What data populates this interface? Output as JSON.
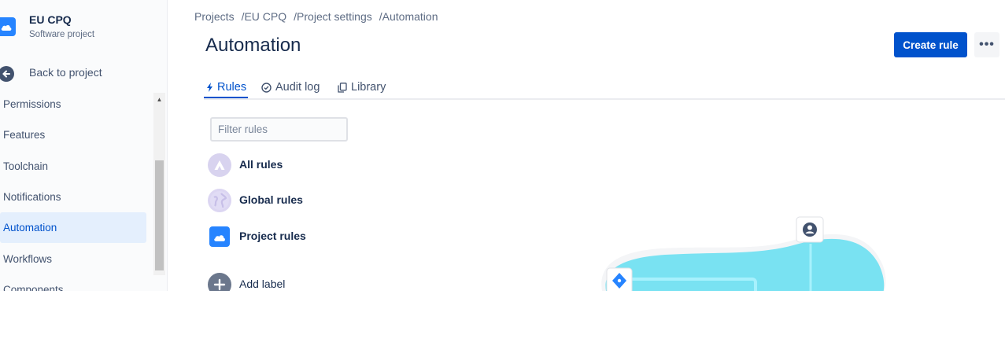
{
  "sidebar": {
    "project_name": "EU CPQ",
    "project_type": "Software project",
    "back_label": "Back to project",
    "items": [
      {
        "label": "Permissions"
      },
      {
        "label": "Features"
      },
      {
        "label": "Toolchain"
      },
      {
        "label": "Notifications"
      },
      {
        "label": "Automation",
        "active": true
      },
      {
        "label": "Workflows"
      },
      {
        "label": "Components"
      }
    ]
  },
  "breadcrumb": [
    "Projects",
    "EU CPQ",
    "Project settings",
    "Automation"
  ],
  "header": {
    "title": "Automation",
    "create_label": "Create rule",
    "more_label": "•••"
  },
  "tabs": [
    {
      "label": "Rules",
      "icon": "bolt-icon",
      "active": true
    },
    {
      "label": "Audit log",
      "icon": "check-circle-icon"
    },
    {
      "label": "Library",
      "icon": "copy-icon"
    }
  ],
  "filter": {
    "placeholder": "Filter rules",
    "value": ""
  },
  "rule_groups": [
    {
      "label": "All rules",
      "icon": "atlassian-icon"
    },
    {
      "label": "Global rules",
      "icon": "globe-icon"
    },
    {
      "label": "Project rules",
      "icon": "cloud-icon"
    }
  ],
  "add_label": "Add label",
  "colors": {
    "brand": "#0052cc",
    "active_bg": "#e4effd",
    "illustration": "#79e2f2"
  }
}
